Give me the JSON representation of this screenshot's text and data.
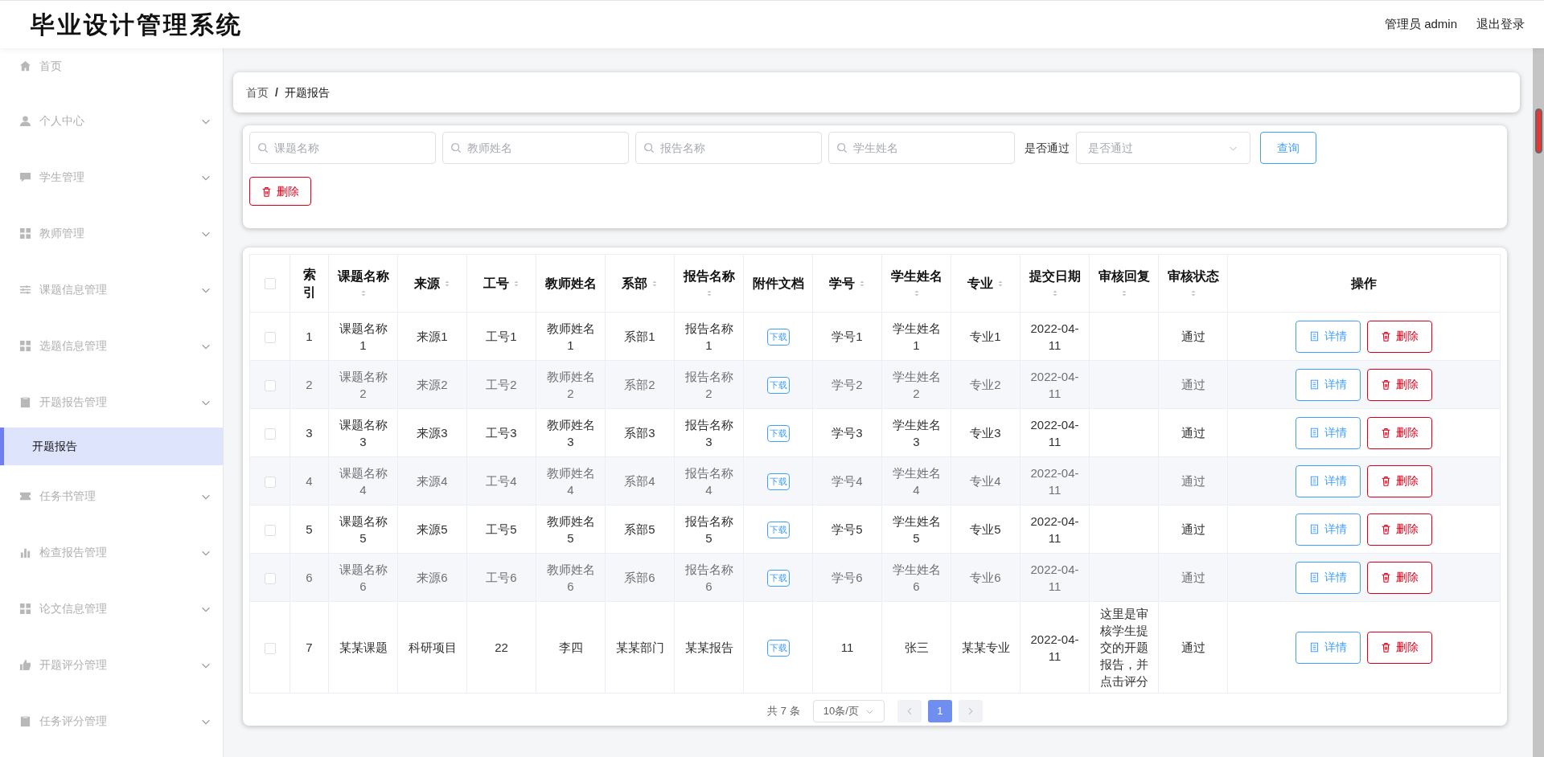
{
  "header": {
    "title": "毕业设计管理系统",
    "user": "管理员 admin",
    "logout": "退出登录"
  },
  "sidebar": {
    "items": [
      {
        "label": "首页",
        "expandable": false
      },
      {
        "label": "个人中心",
        "expandable": true
      },
      {
        "label": "学生管理",
        "expandable": true
      },
      {
        "label": "教师管理",
        "expandable": true
      },
      {
        "label": "课题信息管理",
        "expandable": true
      },
      {
        "label": "选题信息管理",
        "expandable": true
      },
      {
        "label": "开题报告管理",
        "expandable": true,
        "children": [
          {
            "label": "开题报告",
            "selected": true
          }
        ]
      },
      {
        "label": "任务书管理",
        "expandable": true
      },
      {
        "label": "检查报告管理",
        "expandable": true
      },
      {
        "label": "论文信息管理",
        "expandable": true
      },
      {
        "label": "开题评分管理",
        "expandable": true
      },
      {
        "label": "任务评分管理",
        "expandable": true
      }
    ]
  },
  "breadcrumb": {
    "items": [
      "首页",
      "开题报告"
    ],
    "separator": "/"
  },
  "filters": {
    "fields": [
      {
        "placeholder": "课题名称"
      },
      {
        "placeholder": "教师姓名"
      },
      {
        "placeholder": "报告名称"
      },
      {
        "placeholder": "学生姓名"
      }
    ],
    "select_label": "是否通过",
    "select_placeholder": "是否通过",
    "search_button": "查询",
    "delete_button": "删除"
  },
  "table": {
    "all_checked": false,
    "columns": [
      {
        "label": "索引",
        "sortable": false
      },
      {
        "label": "课题名称",
        "sortable": true
      },
      {
        "label": "来源",
        "sortable": true
      },
      {
        "label": "工号",
        "sortable": true
      },
      {
        "label": "教师姓名",
        "sortable": false
      },
      {
        "label": "系部",
        "sortable": true
      },
      {
        "label": "报告名称",
        "sortable": true
      },
      {
        "label": "附件文档",
        "sortable": false
      },
      {
        "label": "学号",
        "sortable": true
      },
      {
        "label": "学生姓名",
        "sortable": true
      },
      {
        "label": "专业",
        "sortable": true
      },
      {
        "label": "提交日期",
        "sortable": true
      },
      {
        "label": "审核回复",
        "sortable": true
      },
      {
        "label": "审核状态",
        "sortable": true
      },
      {
        "label": "操作",
        "sortable": false
      }
    ],
    "rows": [
      {
        "checked": false,
        "index": "1",
        "topic": "课题名称1",
        "source": "来源1",
        "staff_no": "工号1",
        "teacher": "教师姓名1",
        "dept": "系部1",
        "report": "报告名称1",
        "attachment": "下载",
        "student_no": "学号1",
        "student": "学生姓名1",
        "major": "专业1",
        "date": "2022-04-11",
        "reply": "",
        "status": "通过",
        "actions": [
          "详情",
          "删除"
        ]
      },
      {
        "checked": false,
        "index": "2",
        "topic": "课题名称2",
        "source": "来源2",
        "staff_no": "工号2",
        "teacher": "教师姓名2",
        "dept": "系部2",
        "report": "报告名称2",
        "attachment": "下载",
        "student_no": "学号2",
        "student": "学生姓名2",
        "major": "专业2",
        "date": "2022-04-11",
        "reply": "",
        "status": "通过",
        "actions": [
          "详情",
          "删除"
        ]
      },
      {
        "checked": false,
        "index": "3",
        "topic": "课题名称3",
        "source": "来源3",
        "staff_no": "工号3",
        "teacher": "教师姓名3",
        "dept": "系部3",
        "report": "报告名称3",
        "attachment": "下载",
        "student_no": "学号3",
        "student": "学生姓名3",
        "major": "专业3",
        "date": "2022-04-11",
        "reply": "",
        "status": "通过",
        "actions": [
          "详情",
          "删除"
        ]
      },
      {
        "checked": false,
        "index": "4",
        "topic": "课题名称4",
        "source": "来源4",
        "staff_no": "工号4",
        "teacher": "教师姓名4",
        "dept": "系部4",
        "report": "报告名称4",
        "attachment": "下载",
        "student_no": "学号4",
        "student": "学生姓名4",
        "major": "专业4",
        "date": "2022-04-11",
        "reply": "",
        "status": "通过",
        "actions": [
          "详情",
          "删除"
        ]
      },
      {
        "checked": false,
        "index": "5",
        "topic": "课题名称5",
        "source": "来源5",
        "staff_no": "工号5",
        "teacher": "教师姓名5",
        "dept": "系部5",
        "report": "报告名称5",
        "attachment": "下载",
        "student_no": "学号5",
        "student": "学生姓名5",
        "major": "专业5",
        "date": "2022-04-11",
        "reply": "",
        "status": "通过",
        "actions": [
          "详情",
          "删除"
        ]
      },
      {
        "checked": false,
        "index": "6",
        "topic": "课题名称6",
        "source": "来源6",
        "staff_no": "工号6",
        "teacher": "教师姓名6",
        "dept": "系部6",
        "report": "报告名称6",
        "attachment": "下载",
        "student_no": "学号6",
        "student": "学生姓名6",
        "major": "专业6",
        "date": "2022-04-11",
        "reply": "",
        "status": "通过",
        "actions": [
          "详情",
          "删除"
        ]
      },
      {
        "checked": false,
        "index": "7",
        "topic": "某某课题",
        "source": "科研项目",
        "staff_no": "22",
        "teacher": "李四",
        "dept": "某某部门",
        "report": "某某报告",
        "attachment": "下载",
        "student_no": "11",
        "student": "张三",
        "major": "某某专业",
        "date": "2022-04-11",
        "reply": "这里是审核学生提交的开题报告，并点击评分",
        "status": "通过",
        "actions": [
          "详情",
          "删除"
        ]
      }
    ]
  },
  "pagination": {
    "total": "共 7 条",
    "page_size": "10条/页",
    "pages": [
      {
        "label": "1",
        "selected": true
      }
    ]
  }
}
